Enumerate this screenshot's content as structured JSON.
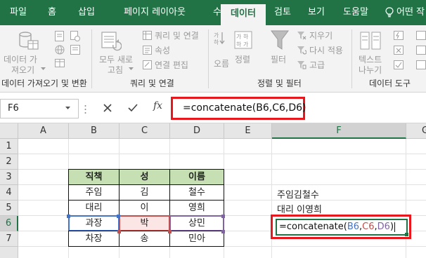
{
  "ribbon_tabs": [
    "파일",
    "홈",
    "삽입",
    "페이지 레이아웃",
    "수식",
    "데이터",
    "검토",
    "보기",
    "도움말",
    "어떤 작"
  ],
  "active_tab": "데이터",
  "ribbon": {
    "get_data": {
      "line1": "데이터 가",
      "line2": "져오기"
    },
    "refresh_all": {
      "line1": "모두 새로",
      "line2": "고침"
    },
    "queries_connections": "쿼리 및 연결",
    "properties": "속성",
    "edit_links": "연결 편집",
    "sort_asc": "오름",
    "sort": "정렬",
    "filter": "필터",
    "clear": "지우기",
    "reapply": "다시 적용",
    "advanced": "고급",
    "text_to_columns": {
      "line1": "텍스트",
      "line2": "나누기"
    },
    "groups": {
      "get_transform": "데이터 가져오기 및 변환",
      "queries": "쿼리 및 연결",
      "sort_filter": "정렬 및 필터",
      "data_tools": "데이터 도구"
    }
  },
  "formula_bar": {
    "name_box": "F6",
    "formula": "=concatenate(B6,C6,D6)",
    "fx": "fx"
  },
  "grid": {
    "columns": [
      "A",
      "B",
      "C",
      "D",
      "E",
      "F",
      "G"
    ],
    "rows": [
      "1",
      "2",
      "3",
      "4",
      "5",
      "6",
      "7"
    ],
    "selected_column": "F",
    "selected_row": "6",
    "table": {
      "headers": [
        "직책",
        "성",
        "이름"
      ],
      "rows": [
        [
          "주임",
          "김",
          "철수"
        ],
        [
          "대리",
          "이",
          "영희"
        ],
        [
          "과장",
          "박",
          "상민"
        ],
        [
          "차장",
          "송",
          "민아"
        ]
      ]
    },
    "f_column": {
      "f4": "주임김철수",
      "f5": "대리 이영희"
    },
    "edit_cell": {
      "prefix": "=concatenate(",
      "ref1": "B6",
      "sep1": ",",
      "ref2": "C6",
      "sep2": ",",
      "ref3": "D6",
      "suffix": ")"
    }
  },
  "colors": {
    "excel_green": "#217346",
    "highlight_red": "#e8161d",
    "header_fill": "#c6e0b4",
    "ref_blue": "#4472c4",
    "ref_red": "#c0504d",
    "ref_purple": "#8064a2"
  }
}
